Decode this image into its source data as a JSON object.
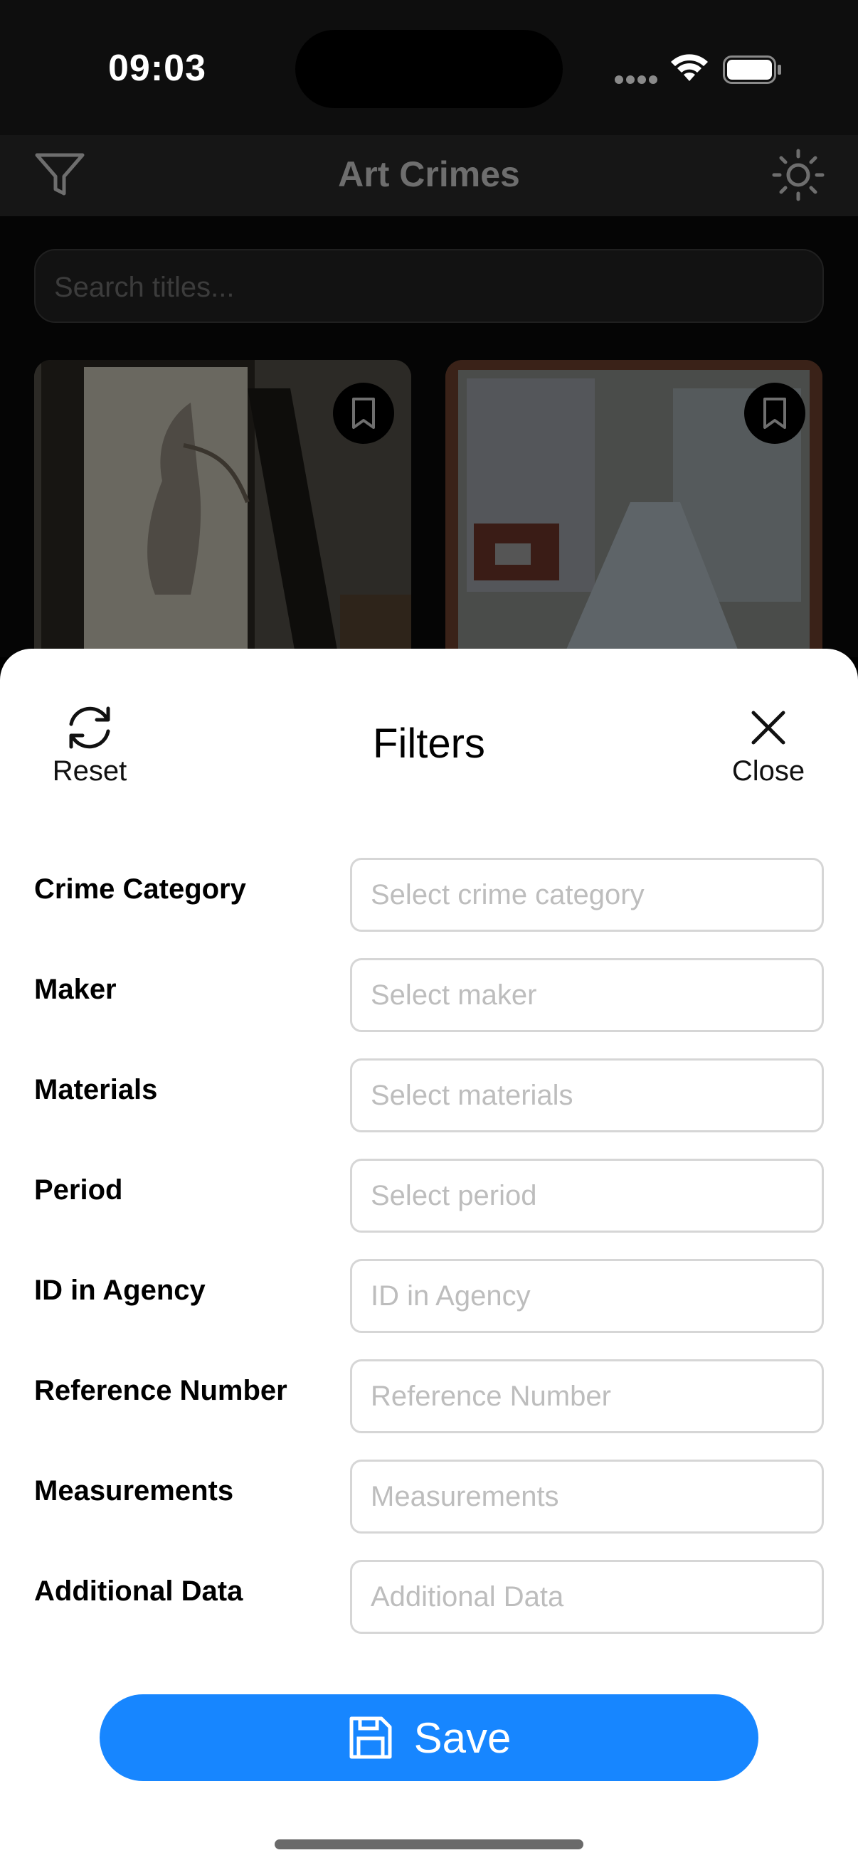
{
  "status_bar": {
    "time": "09:03"
  },
  "nav": {
    "title": "Art Crimes",
    "filter_icon": "filter-icon",
    "theme_icon": "sun-icon"
  },
  "search": {
    "placeholder": "Search titles..."
  },
  "cards": [
    {
      "bookmark_icon": "bookmark-icon"
    },
    {
      "bookmark_icon": "bookmark-icon"
    }
  ],
  "sheet": {
    "title": "Filters",
    "reset_label": "Reset",
    "reset_icon": "refresh-icon",
    "close_label": "Close",
    "close_icon": "close-icon",
    "fields": [
      {
        "label": "Crime Category",
        "placeholder": "Select crime category"
      },
      {
        "label": "Maker",
        "placeholder": "Select maker"
      },
      {
        "label": "Materials",
        "placeholder": "Select materials"
      },
      {
        "label": "Period",
        "placeholder": "Select period"
      },
      {
        "label": "ID in Agency",
        "placeholder": "ID in Agency"
      },
      {
        "label": "Reference Number",
        "placeholder": "Reference Number"
      },
      {
        "label": "Measurements",
        "placeholder": "Measurements"
      },
      {
        "label": "Additional Data",
        "placeholder": "Additional Data"
      }
    ],
    "save_label": "Save",
    "save_icon": "floppy-disk-icon"
  },
  "colors": {
    "accent": "#1786ff",
    "sheet_background": "#ffffff",
    "overlay_background": "#000000"
  }
}
